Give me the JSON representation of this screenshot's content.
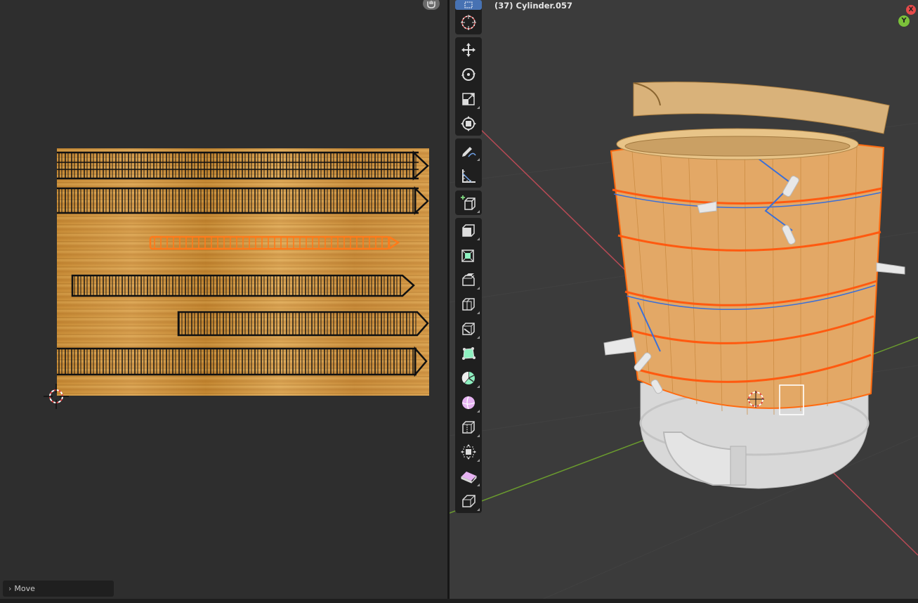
{
  "uv_editor": {
    "operator_panel": {
      "label": "Move",
      "collapsed": true
    }
  },
  "viewport": {
    "object_label": "(37) Cylinder.057",
    "gizmo": {
      "x_label": "X",
      "y_label": "Y"
    }
  },
  "toolbar": {
    "tools": [
      {
        "name": "select-box",
        "icon": "select-box-icon",
        "active": true
      },
      {
        "name": "cursor",
        "icon": "cursor-icon"
      },
      {
        "name": "move",
        "icon": "move-icon"
      },
      {
        "name": "rotate",
        "icon": "rotate-icon"
      },
      {
        "name": "scale",
        "icon": "scale-icon"
      },
      {
        "name": "transform",
        "icon": "transform-icon"
      },
      {
        "name": "annotate",
        "icon": "annotate-icon"
      },
      {
        "name": "measure",
        "icon": "measure-icon"
      },
      {
        "name": "add-cube",
        "icon": "add-cube-icon"
      },
      {
        "name": "extrude-region",
        "icon": "extrude-region-icon"
      },
      {
        "name": "inset-faces",
        "icon": "inset-faces-icon"
      },
      {
        "name": "bevel",
        "icon": "bevel-icon"
      },
      {
        "name": "loop-cut",
        "icon": "loop-cut-icon"
      },
      {
        "name": "knife",
        "icon": "knife-icon"
      },
      {
        "name": "poly-build",
        "icon": "poly-build-icon"
      },
      {
        "name": "spin",
        "icon": "spin-icon"
      },
      {
        "name": "smooth",
        "icon": "smooth-icon"
      },
      {
        "name": "edge-slide",
        "icon": "edge-slide-icon"
      },
      {
        "name": "shrink-fatten",
        "icon": "shrink-fatten-icon"
      },
      {
        "name": "shear",
        "icon": "shear-icon"
      },
      {
        "name": "rip-region",
        "icon": "rip-region-icon"
      }
    ]
  },
  "colors": {
    "selection_orange": "#ff7a1a",
    "active_tool_blue": "#4772b3",
    "panel_dark": "#1f1f1f",
    "wood": "#d39a48",
    "axis_x": "#e64a4a",
    "axis_y": "#7bc23a"
  }
}
